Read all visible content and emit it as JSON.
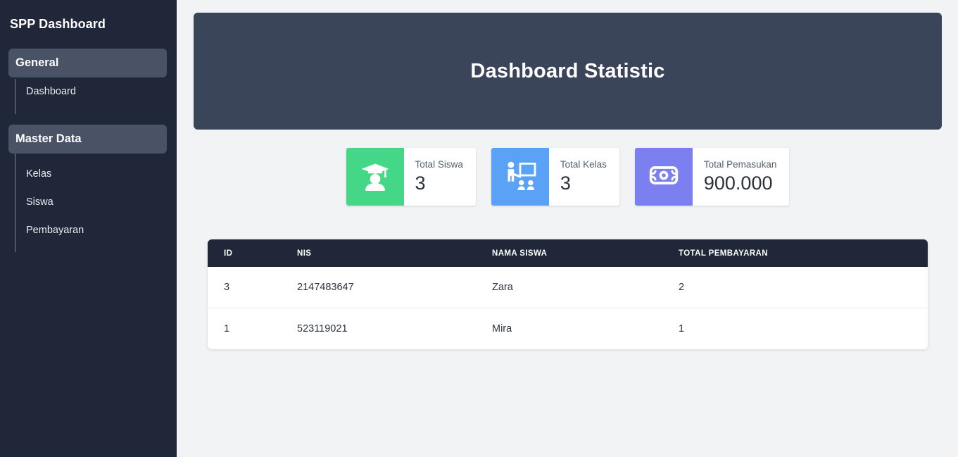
{
  "sidebar": {
    "brand": "SPP Dashboard",
    "groups": [
      {
        "header": "General",
        "items": [
          {
            "label": "Dashboard"
          }
        ]
      },
      {
        "header": "Master Data",
        "items": [
          {
            "label": "Kelas"
          },
          {
            "label": "Siswa"
          },
          {
            "label": "Pembayaran"
          }
        ]
      }
    ]
  },
  "banner": {
    "title": "Dashboard Statistic"
  },
  "cards": [
    {
      "icon": "student-graduate-icon",
      "label": "Total Siswa",
      "value": "3",
      "color": "#43d787"
    },
    {
      "icon": "teacher-classroom-icon",
      "label": "Total Kelas",
      "value": "3",
      "color": "#5aa2f5"
    },
    {
      "icon": "money-banknote-icon",
      "label": "Total Pemasukan",
      "value": "900.000",
      "color": "#7b7ff0"
    }
  ],
  "table": {
    "columns": [
      "ID",
      "NIS",
      "NAMA SISWA",
      "TOTAL PEMBAYARAN"
    ],
    "rows": [
      {
        "id": "3",
        "nis": "2147483647",
        "nama": "Zara",
        "total": "2"
      },
      {
        "id": "1",
        "nis": "523119021",
        "nama": "Mira",
        "total": "1"
      }
    ]
  },
  "colors": {
    "sidebar_bg": "#1f2738",
    "banner_bg": "#3b4559",
    "content_bg": "#f1f3f5",
    "section_header_bg": "#4a5366"
  }
}
